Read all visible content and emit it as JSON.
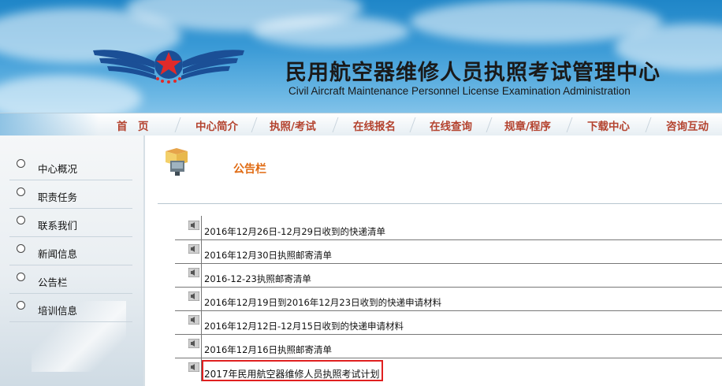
{
  "header": {
    "title_cn": "民用航空器维修人员执照考试管理中心",
    "title_en": "Civil Aircraft Maintenance Personnel License Examination Administration"
  },
  "nav": {
    "items": [
      {
        "label": "首　页"
      },
      {
        "label": "中心简介"
      },
      {
        "label": "执照/考试"
      },
      {
        "label": "在线报名"
      },
      {
        "label": "在线查询"
      },
      {
        "label": "规章/程序"
      },
      {
        "label": "下载中心"
      },
      {
        "label": "咨询互动"
      }
    ]
  },
  "sidebar": {
    "items": [
      {
        "label": "中心概况"
      },
      {
        "label": "职责任务"
      },
      {
        "label": "联系我们"
      },
      {
        "label": "新闻信息"
      },
      {
        "label": "公告栏"
      },
      {
        "label": "培训信息"
      }
    ]
  },
  "main": {
    "section_title": "公告栏",
    "notices": [
      {
        "text": "2016年12月26日-12月29日收到的快递清单"
      },
      {
        "text": "2016年12月30日执照邮寄清单"
      },
      {
        "text": "2016-12-23执照邮寄清单"
      },
      {
        "text": "2016年12月19日到2016年12月23日收到的快递申请材料"
      },
      {
        "text": "2016年12月12日-12月15日收到的快递申请材料"
      },
      {
        "text": "2016年12月16日执照邮寄清单"
      },
      {
        "text": "2017年民用航空器维修人员执照考试计划"
      }
    ]
  },
  "colors": {
    "nav_text": "#b4432f",
    "section_title": "#e06a12",
    "highlight": "#e02020"
  }
}
